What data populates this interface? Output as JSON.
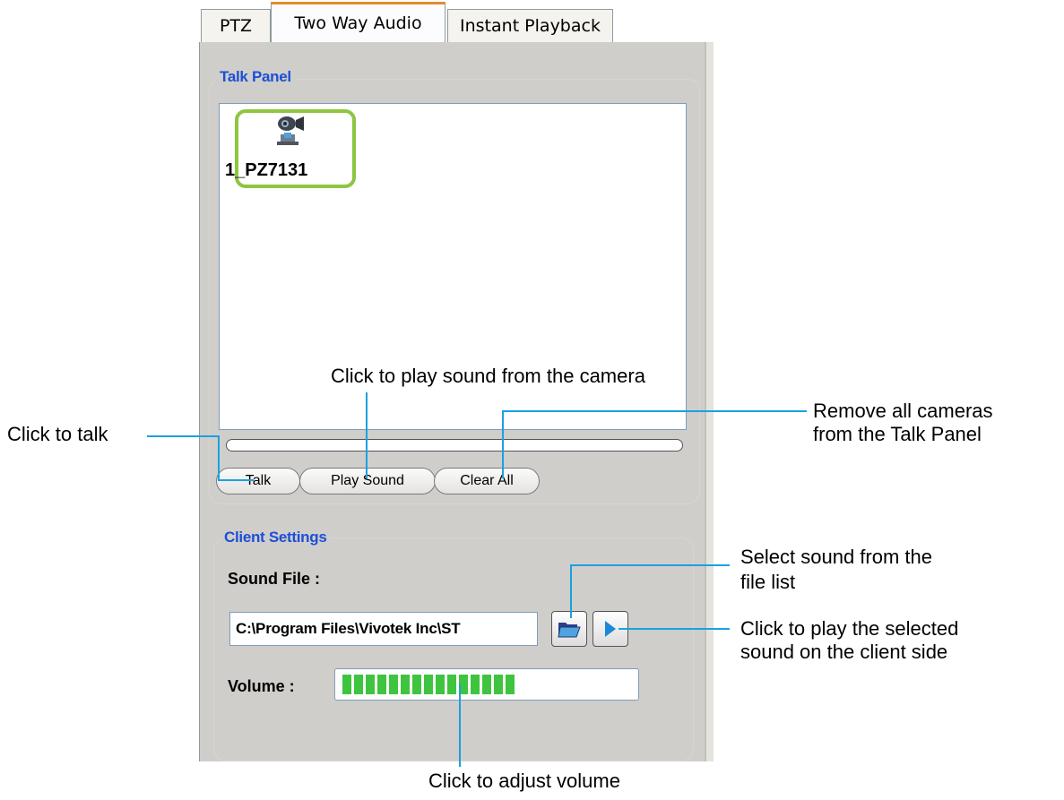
{
  "tabs": [
    {
      "label": "PTZ",
      "active": false
    },
    {
      "label": "Two Way Audio",
      "active": true
    },
    {
      "label": "Instant Playback",
      "active": false
    }
  ],
  "talk_panel": {
    "title": "Talk Panel",
    "camera_label": "1_PZ7131",
    "buttons": {
      "talk": "Talk",
      "play_sound": "Play Sound",
      "clear_all": "Clear All"
    }
  },
  "client_settings": {
    "title": "Client Settings",
    "sound_file_label": "Sound File :",
    "sound_file_path": "C:\\Program Files\\Vivotek Inc\\ST",
    "volume_label": "Volume :",
    "volume_level": 0.66,
    "volume_segments_filled": 15
  },
  "callouts": {
    "play_sound": "Click to play sound from the camera",
    "talk": "Click to talk",
    "remove_line1": "Remove all cameras",
    "remove_line2": "from the Talk Panel",
    "select_line1": "Select sound from the",
    "select_line2": "file list",
    "play_selected_line1": "Click to play the selected",
    "play_selected_line2": "sound on the client side",
    "adjust_volume": "Click to adjust volume"
  },
  "colors": {
    "accent_tab": "#e68b2c",
    "group_title": "#1d4fd6",
    "selection_border": "#8dc63f",
    "volume_fill": "#3ec43e",
    "callout_line": "#1aa1e0"
  },
  "icons": {
    "camera": "ptz-camera-icon",
    "browse": "open-folder-icon",
    "play": "play-triangle-icon"
  }
}
